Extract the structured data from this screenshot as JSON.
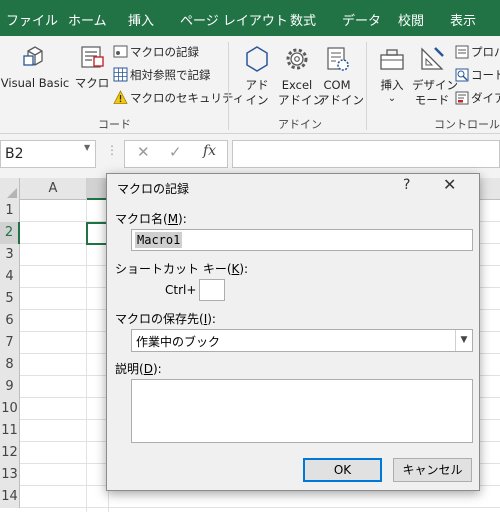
{
  "ribbon_tabs": [
    "ファイル",
    "ホーム",
    "挿入",
    "ページ レイアウト",
    "数式",
    "データ",
    "校閲",
    "表示"
  ],
  "ribbon": {
    "visual_basic": "Visual Basic",
    "macro": "マクロ",
    "record_macro": "マクロの記録",
    "relative_ref": "相対参照で記録",
    "macro_security": "マクロのセキュリティ",
    "code_group": "コード",
    "addin_line1": "アド",
    "addin_line2": "イン",
    "excel_addin_line1": "Excel",
    "excel_addin_line2": "アドイン",
    "com_addin_line1": "COM",
    "com_addin_line2": "アドイン",
    "addin_group": "アドイン",
    "insert": "挿入",
    "insert_arrow": "⌄",
    "design_mode_line1": "デザイン",
    "design_mode_line2": "モード",
    "properties": "プロパ",
    "view_code": "コード",
    "dialog": "ダイア",
    "controls_group": "コントロール"
  },
  "formula_bar": {
    "name_box": "B2",
    "fx": "fx",
    "cancel_icon": "✕",
    "enter_icon": "✓"
  },
  "grid": {
    "col_a": "A",
    "rows": [
      "1",
      "2",
      "3",
      "4",
      "5",
      "6",
      "7",
      "8",
      "9",
      "10",
      "11",
      "12",
      "13",
      "14"
    ]
  },
  "dialog": {
    "title": "マクロの記録",
    "help": "?",
    "close": "✕",
    "macro_name_label_pre": "マクロ名(",
    "macro_name_label_key": "M",
    "macro_name_label_post": "):",
    "macro_name_value": "Macro1",
    "shortcut_label_pre": "ショートカット キー(",
    "shortcut_label_key": "K",
    "shortcut_label_post": "):",
    "ctrl_label": "Ctrl+",
    "shortcut_value": "",
    "store_label_pre": "マクロの保存先(",
    "store_label_key": "I",
    "store_label_post": "):",
    "store_value": "作業中のブック",
    "description_label_pre": "説明(",
    "description_label_key": "D",
    "description_label_post": "):",
    "description_value": "",
    "ok": "OK",
    "cancel": "キャンセル"
  },
  "colors": {
    "ribbon_green": "#217346",
    "ribbon_bg": "#f3f3f3",
    "dialog_bg": "#f0f0f0",
    "focus_blue": "#0078d7"
  }
}
